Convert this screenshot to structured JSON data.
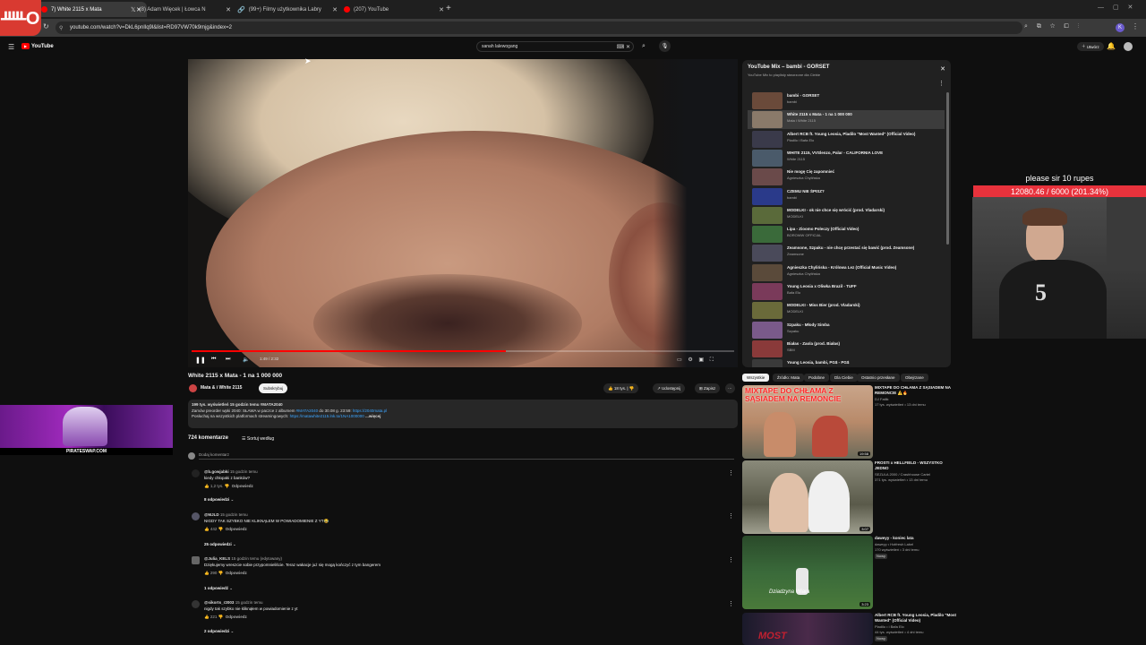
{
  "browser": {
    "tabs": [
      {
        "label": "7) White 2115 x Mata",
        "color": "#ff0000"
      },
      {
        "label": "(8) Adam Więcek | Łowca N",
        "color": "#ffffff"
      },
      {
        "label": "(99+) Filmy użytkownika Labry",
        "color": "#6fa8ff"
      },
      {
        "label": "(207) YouTube",
        "color": "#ff0000"
      }
    ],
    "new_tab": "+",
    "url": "youtube.com/watch?v=DkL6pnIlq9l&list=RD97VW70k9mjg&index=2",
    "profile": "K"
  },
  "youtube": {
    "logo": "YouTube",
    "search_value": "sanah lalewogang",
    "create_label": "Utwórz"
  },
  "video": {
    "time": "1:49 / 2:32",
    "progress": 0.58,
    "title": "White 2115 x Mata - 1 na 1 000 000",
    "channel": "Mata & i White 2115",
    "subscribe": "Subskrybuj",
    "likes": "18 tys.",
    "share": "Udostępnij",
    "save": "Zapisz",
    "desc_line1": "199 tys. wyświetleń  15 godzin temu  #MATA2040",
    "desc_line2_prefix": "Zamów preorder wpki 2040: SŁAWA w paczce z albumem",
    "desc_line2_tag": "#MATA2040",
    "desc_line2_mid": "do 30.08 g. 23:59:",
    "desc_line2_link": "https://2040mata.pl",
    "desc_line3_prefix": "Posłuchaj na wszystkich platformach streamingowych:",
    "desc_line3_link": "https://matawhite2115.lnk.to/1NA1000000",
    "desc_more": "...więcej"
  },
  "comments": {
    "count": "724 komentarze",
    "sort": "Sortuj według",
    "add": "Dodaj komentarz",
    "items": [
      {
        "author": "@b.gowjabki",
        "time": "15 godzin temu",
        "text": "kiedy chłopaki z banków?",
        "likes": "1,2 tys.",
        "reply": "Odpowiedz",
        "replies": "8 odpowiedzi"
      },
      {
        "author": "@MJLD",
        "time": "15 godzin temu",
        "text": "NIGDY TAK SZYBKO NIE KLIKNĄŁEM W POWIADOMIENIE Z YT😂",
        "likes": "442",
        "reply": "Odpowiedz",
        "replies": "25 odpowiedzi"
      },
      {
        "author": "@Julia_KELS",
        "time": "15 godzin temu (edytowany)",
        "text": "Dziękujemy wreszcie sobie przypomnieliście. Teraz wakacje już się mogą kończyć z tym bangerem",
        "likes": "290",
        "reply": "Odpowiedz",
        "replies": "1 odpowiedź"
      },
      {
        "author": "@sikorts_r2003",
        "time": "15 godzin temu",
        "text": "nigdy tak szybko nie kliknąłem w powiadomienie z yt",
        "likes": "221",
        "reply": "Odpowiedz",
        "replies": "2 odpowiedzi"
      }
    ]
  },
  "playlist": {
    "title": "YouTube Mix – bambi - GORSET",
    "subtitle": "YouTube Mix to playlisty stworzone dla Ciebie",
    "items": [
      {
        "title": "bambi - GORSET",
        "artist": "bambi",
        "color": "#6a4a3a"
      },
      {
        "title": "White 2115 x Mata - 1 na 1 000 000",
        "artist": "Mata i White 2115",
        "color": "#8a7a6a"
      },
      {
        "title": "Albert RCB ft. Young Leosia, Pladilo \"Most Wanted\" (Official Video)",
        "artist": "Pladilo i Bafa Elo",
        "color": "#3a3a4a"
      },
      {
        "title": "WHITE 2115, VVSlenzo, Palar - CALIFORNIA LOVE",
        "artist": "White 2115",
        "color": "#4a5a6a"
      },
      {
        "title": "Nie mogę Cię zapomnieć",
        "artist": "Agnieszka Chylińska",
        "color": "#6a4a4a"
      },
      {
        "title": "CZEMU NIE ŚPISZ?",
        "artist": "bambi",
        "color": "#2a3a8a"
      },
      {
        "title": "MODELKI - ok nie chce się wrócić (prod. Vladarski)",
        "artist": "MODELKI",
        "color": "#5a6a3a"
      },
      {
        "title": "Lipa - Zioomo Poleczy (Official Video)",
        "artist": "BOROWW OFFICIAL",
        "color": "#3a6a3a"
      },
      {
        "title": "Zeamsone, Szpaku - nie chcę przestać się bawić (prod. Zeamsone)",
        "artist": "Zeamsone",
        "color": "#4a4a5a"
      },
      {
        "title": "Agnieszka Chylińska - Królowa Lez (Official Music Video)",
        "artist": "Agnieszka Chylińska",
        "color": "#5a4a3a"
      },
      {
        "title": "Young Leosia x Oliwka Brazil - TUFF",
        "artist": "Bafa Elo",
        "color": "#7a3a5a"
      },
      {
        "title": "MODELKI - Miss Bier (prod. Vladarski)",
        "artist": "MODELKI",
        "color": "#6a6a3a"
      },
      {
        "title": "Szpaku - Młody Simba",
        "artist": "Szpaku",
        "color": "#7a5a8a"
      },
      {
        "title": "Białas - Zaola (prod. Białas)",
        "artist": "SBM",
        "color": "#8a3a3a"
      },
      {
        "title": "Young Leosia, bambi, PG$ - PG$",
        "artist": "Bafa Elo",
        "color": "#3a3a3a"
      }
    ]
  },
  "chips": [
    "Wszystkie",
    "Źródło: Mata",
    "Podobne",
    "Dla Ciebie",
    "Ostatnio przesłane",
    "Obejrzane"
  ],
  "recommendations": [
    {
      "overlay": "MIXTAPE DO CHŁAMA Z SĄSIADEM NA REMONCIE",
      "title": "MIXTAPE DO CHŁAMA Z SĄSIADEM NA REMONCIE ⚠️🔥",
      "channel": "DJ Fatlik",
      "meta": "17 tys. wyświetleń • 13 dni temu",
      "duration": "19:58"
    },
    {
      "overlay": "",
      "title": "FROSTI x HELLFIELD - WSZYSTKO JEDNO",
      "channel": "SEZULA 2000 / Crashhouse Cartel",
      "meta": "371 tys. wyświetleń • 13 dni temu",
      "duration": "3:07"
    },
    {
      "overlay": "Dziadzyna Wiara",
      "title": "daweyy - koniec lata",
      "channel": "daweyy • Hotfresh Label",
      "meta": "170 wyświetleń • 3 dni temu",
      "badge": "Nowy",
      "duration": "3:23"
    },
    {
      "overlay": "",
      "title": "Albert RCB ft. Young Leosia, Pladilo \"Most Wanted\" (Official Video)",
      "channel": "Pladilo • i Bafa Elo",
      "meta": "44 tys. wyświetleń • 4 dni temu",
      "badge": "Nowy",
      "duration": ""
    }
  ],
  "stream": {
    "donation_title": "please sir 10 rupes",
    "donation_goal": "12080.46 / 6000 (201.34%)",
    "donation_progress": 1.0,
    "ad_label": "PIRATESWAP.COM"
  }
}
